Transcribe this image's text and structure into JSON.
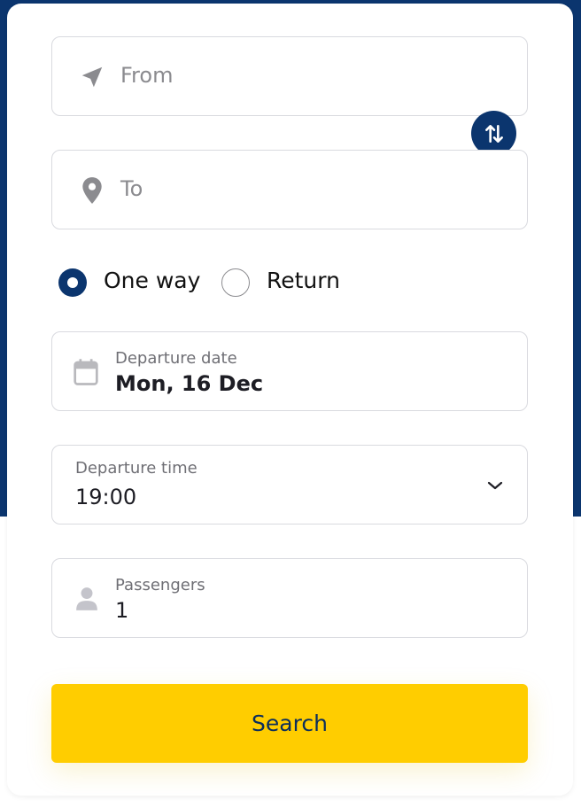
{
  "from": {
    "placeholder": "From"
  },
  "to": {
    "placeholder": "To"
  },
  "trip_type": {
    "options": [
      {
        "label": "One way",
        "selected": true
      },
      {
        "label": "Return",
        "selected": false
      }
    ]
  },
  "departure_date": {
    "label": "Departure date",
    "value": "Mon, 16 Dec"
  },
  "departure_time": {
    "label": "Departure time",
    "value": "19:00"
  },
  "passengers": {
    "label": "Passengers",
    "value": "1"
  },
  "search_button": {
    "label": "Search"
  },
  "icons": {
    "from": "navigation-arrow-icon",
    "to": "map-pin-icon",
    "swap": "swap-vertical-icon",
    "date": "calendar-icon",
    "time": "chevron-down-icon",
    "passengers": "person-icon"
  },
  "colors": {
    "brand_navy": "#0b356e",
    "accent_yellow": "#ffcd00",
    "border": "#d9dadf",
    "muted_text": "#8b8b8f"
  }
}
